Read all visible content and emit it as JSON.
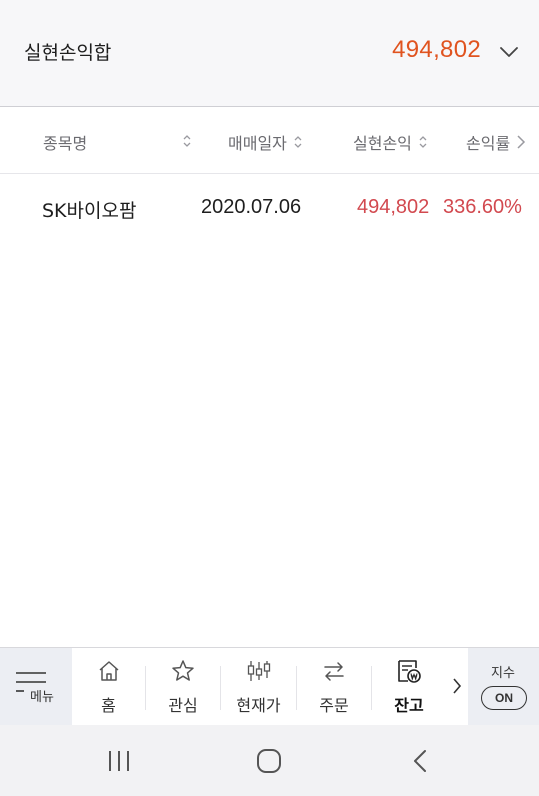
{
  "summary": {
    "label": "실현손익합",
    "value": "494,802",
    "value_color": "#e0531f",
    "chevron_icon": "chevron-down-icon"
  },
  "table": {
    "headers": [
      "종목명",
      "매매일자",
      "실현손익",
      "손익률"
    ],
    "rows": [
      {
        "name": "SK바이오팜",
        "date": "2020.07.06",
        "realized": "494,802",
        "rate": "336.60%"
      }
    ],
    "profit_color": "#d2494f"
  },
  "tabbar": {
    "menu_label": "메뉴",
    "tabs": [
      {
        "label": "홈",
        "icon": "home-icon"
      },
      {
        "label": "관심",
        "icon": "star-icon"
      },
      {
        "label": "현재가",
        "icon": "candlestick-icon"
      },
      {
        "label": "주문",
        "icon": "swap-arrows-icon"
      },
      {
        "label": "잔고",
        "icon": "balance-doc-icon",
        "active": true
      }
    ],
    "index_label": "지수",
    "index_toggle": "ON"
  },
  "sysnav": {
    "icons": [
      "recent-apps-icon",
      "home-circle-icon",
      "back-icon"
    ]
  }
}
